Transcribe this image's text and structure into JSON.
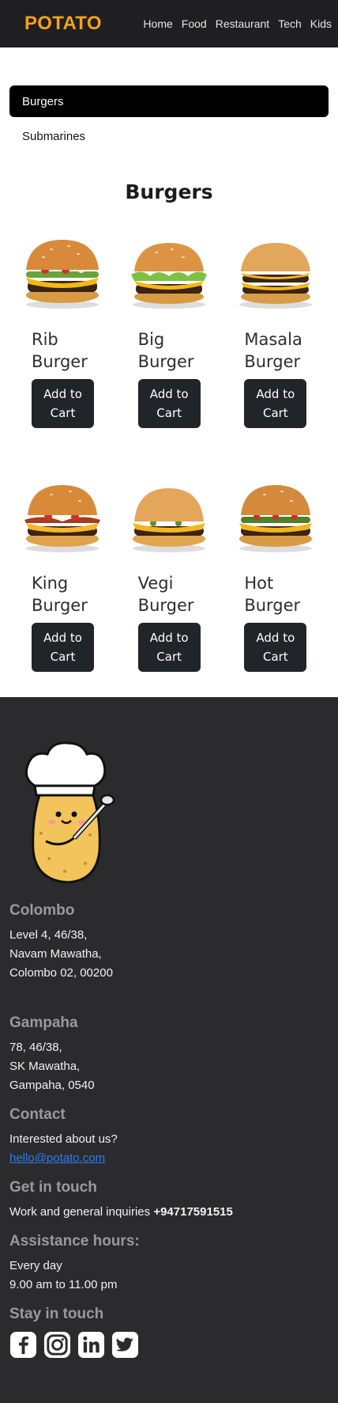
{
  "nav": {
    "brand": "POTATO",
    "links": [
      "Home",
      "Food",
      "Restaurant",
      "Tech",
      "Kids"
    ]
  },
  "categories": [
    {
      "label": "Burgers",
      "active": true
    },
    {
      "label": "Submarines",
      "active": false
    }
  ],
  "section_title": "Burgers",
  "products": [
    {
      "name": "Rib Burger",
      "button": "Add to Cart"
    },
    {
      "name": "Big Burger",
      "button": "Add to Cart"
    },
    {
      "name": "Masala Burger",
      "button": "Add to Cart"
    },
    {
      "name": "King Burger",
      "button": "Add to Cart"
    },
    {
      "name": "Vegi Burger",
      "button": "Add to Cart"
    },
    {
      "name": "Hot Burger",
      "button": "Add to Cart"
    }
  ],
  "footer": {
    "colombo": {
      "heading": "Colombo",
      "lines": [
        "Level 4, 46/38,",
        "Navam Mawatha,",
        "Colombo 02, 00200"
      ]
    },
    "gampaha": {
      "heading": "Gampaha",
      "lines": [
        "78, 46/38,",
        "SK Mawatha,",
        "Gampaha, 0540"
      ]
    },
    "contact": {
      "heading": "Contact",
      "text": "Interested about us?",
      "email": "hello@potato.com"
    },
    "get_in_touch": {
      "heading": "Get in touch",
      "text": "Work and general inquiries",
      "phone": "+94717591515"
    },
    "hours": {
      "heading": "Assistance hours:",
      "lines": [
        "Every day",
        "9.00 am to 11.00 pm"
      ]
    },
    "social": {
      "heading": "Stay in touch",
      "icons": [
        "facebook-icon",
        "instagram-icon",
        "linkedin-icon",
        "twitter-icon"
      ]
    }
  },
  "colors": {
    "brand": "#f5a21b",
    "nav_bg": "#1f1f21",
    "footer_bg": "#2b2b2d",
    "button_bg": "#212529",
    "link": "#2f7bf5"
  }
}
